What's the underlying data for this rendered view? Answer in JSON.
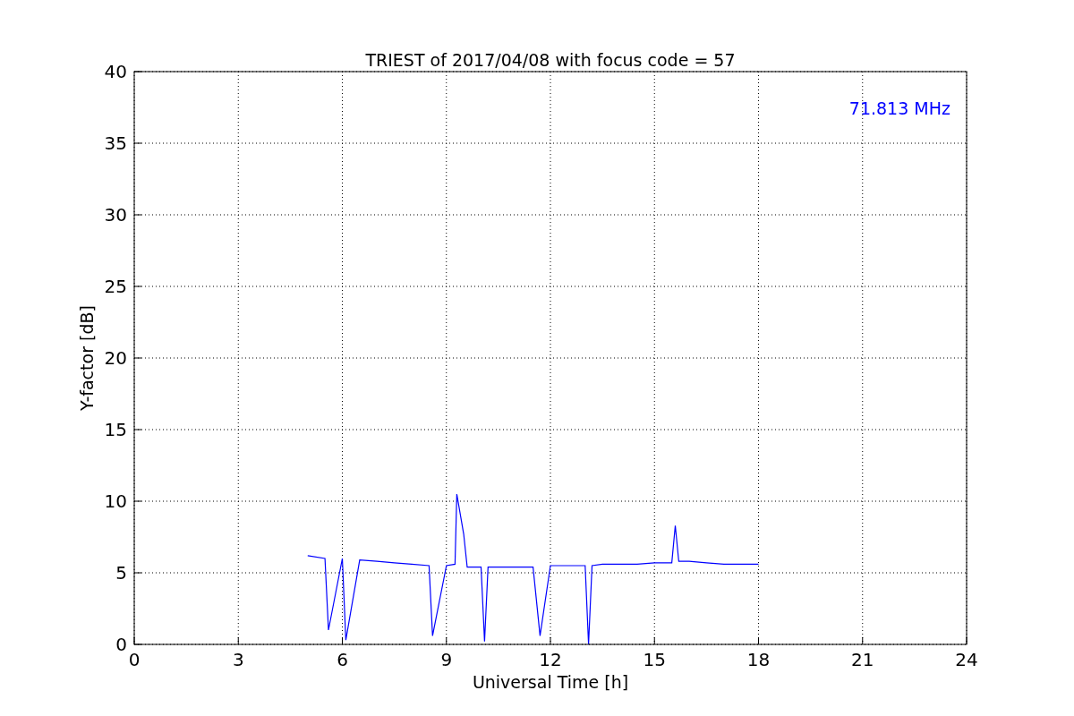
{
  "figure": {
    "chart_data": {
      "type": "line",
      "title": "TRIEST of 2017/04/08 with focus code = 57",
      "xlabel": "Universal Time [h]",
      "ylabel": "Y-factor [dB]",
      "x": [
        5,
        5.5,
        5.6,
        6,
        6.1,
        6.5,
        7,
        7.5,
        8,
        8.5,
        8.6,
        9,
        9.25,
        9.3,
        9.5,
        9.6,
        10,
        10.1,
        10.2,
        11,
        11.5,
        11.7,
        12,
        12.5,
        13,
        13.1,
        13.2,
        13.5,
        14,
        14.5,
        15,
        15.5,
        15.6,
        15.7,
        16,
        16.5,
        17,
        17.5,
        18
      ],
      "series": [
        {
          "name": "71.813 MHz",
          "color": "#0000ff",
          "values": [
            6.2,
            6.0,
            1.0,
            6.0,
            0.3,
            5.9,
            5.8,
            5.7,
            5.6,
            5.5,
            0.6,
            5.5,
            5.6,
            10.5,
            7.7,
            5.4,
            5.4,
            0.2,
            5.4,
            5.4,
            5.4,
            0.6,
            5.5,
            5.5,
            5.5,
            0.0,
            5.5,
            5.6,
            5.6,
            5.6,
            5.7,
            5.7,
            8.3,
            5.8,
            5.8,
            5.7,
            5.6,
            5.6,
            5.6
          ]
        }
      ],
      "xlim": [
        0,
        24
      ],
      "ylim": [
        0,
        40
      ],
      "xticks": [
        0,
        3,
        6,
        9,
        12,
        15,
        18,
        21,
        24
      ],
      "yticks": [
        0,
        5,
        10,
        15,
        20,
        25,
        30,
        35,
        40
      ],
      "grid": true
    }
  }
}
